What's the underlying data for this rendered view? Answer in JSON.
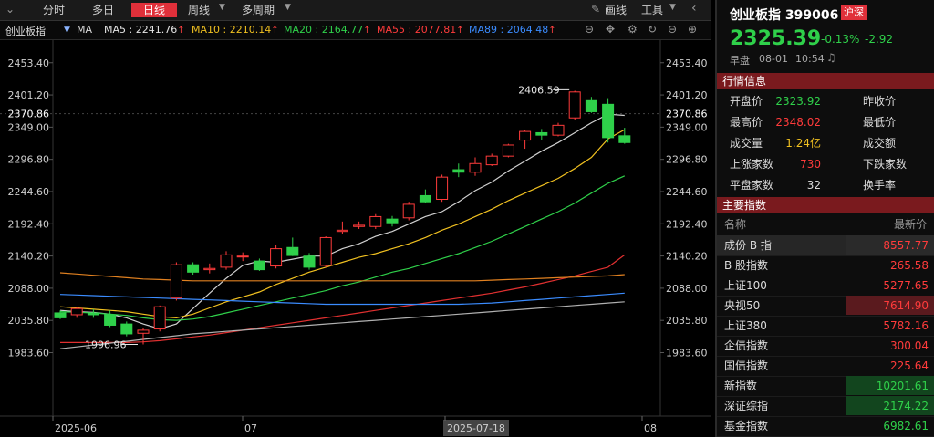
{
  "toolbar": {
    "tabs": [
      {
        "label": "分时",
        "active": false
      },
      {
        "label": "多日",
        "active": false
      },
      {
        "label": "日线",
        "active": true
      },
      {
        "label": "周线",
        "active": false
      },
      {
        "label": "多周期",
        "active": false
      }
    ],
    "draw_label": "画线",
    "tools_label": "工具"
  },
  "ma_bar": {
    "name": "创业板指",
    "ma_label": "MA",
    "items": [
      {
        "label": "MA5 : 2241.76",
        "color": "#e6e6e6"
      },
      {
        "label": "MA10 : 2210.14",
        "color": "#f0c020"
      },
      {
        "label": "MA20 : 2164.77",
        "color": "#2fd04a"
      },
      {
        "label": "MA55 : 2077.81",
        "color": "#ff3b3b"
      },
      {
        "label": "MA89 : 2064.48",
        "color": "#3b8cff"
      }
    ],
    "arrow": "↑"
  },
  "chart_data": {
    "type": "candlestick",
    "ylim": [
      1940,
      2490
    ],
    "y_ticks": [
      "2453.40",
      "2401.20",
      "2349.00",
      "2296.80",
      "2244.60",
      "2192.40",
      "2140.20",
      "2088.00",
      "2035.80",
      "1983.60"
    ],
    "current_price_label": "2370.86",
    "x_labels": [
      "2025-06",
      "07",
      "2025-07-18",
      "08"
    ],
    "annotations": {
      "high": "2406.59",
      "low": "1996.96"
    },
    "candles": [
      {
        "o": 2048,
        "h": 2052,
        "l": 2038,
        "c": 2040
      },
      {
        "o": 2045,
        "h": 2058,
        "l": 2040,
        "c": 2055
      },
      {
        "o": 2048,
        "h": 2054,
        "l": 2040,
        "c": 2045
      },
      {
        "o": 2045,
        "h": 2052,
        "l": 2025,
        "c": 2028
      },
      {
        "o": 2030,
        "h": 2034,
        "l": 2010,
        "c": 2014
      },
      {
        "o": 2015,
        "h": 2024,
        "l": 1997,
        "c": 2020
      },
      {
        "o": 2022,
        "h": 2060,
        "l": 2018,
        "c": 2058
      },
      {
        "o": 2072,
        "h": 2130,
        "l": 2068,
        "c": 2126
      },
      {
        "o": 2126,
        "h": 2130,
        "l": 2110,
        "c": 2114
      },
      {
        "o": 2118,
        "h": 2128,
        "l": 2112,
        "c": 2120
      },
      {
        "o": 2122,
        "h": 2148,
        "l": 2118,
        "c": 2142
      },
      {
        "o": 2140,
        "h": 2146,
        "l": 2132,
        "c": 2140
      },
      {
        "o": 2132,
        "h": 2136,
        "l": 2116,
        "c": 2118
      },
      {
        "o": 2124,
        "h": 2158,
        "l": 2120,
        "c": 2152
      },
      {
        "o": 2154,
        "h": 2170,
        "l": 2140,
        "c": 2141
      },
      {
        "o": 2140,
        "h": 2145,
        "l": 2118,
        "c": 2122
      },
      {
        "o": 2125,
        "h": 2172,
        "l": 2122,
        "c": 2170
      },
      {
        "o": 2180,
        "h": 2196,
        "l": 2176,
        "c": 2182
      },
      {
        "o": 2188,
        "h": 2196,
        "l": 2184,
        "c": 2190
      },
      {
        "o": 2188,
        "h": 2208,
        "l": 2184,
        "c": 2204
      },
      {
        "o": 2200,
        "h": 2205,
        "l": 2188,
        "c": 2194
      },
      {
        "o": 2202,
        "h": 2228,
        "l": 2198,
        "c": 2224
      },
      {
        "o": 2238,
        "h": 2248,
        "l": 2226,
        "c": 2228
      },
      {
        "o": 2232,
        "h": 2272,
        "l": 2228,
        "c": 2268
      },
      {
        "o": 2280,
        "h": 2290,
        "l": 2268,
        "c": 2276
      },
      {
        "o": 2276,
        "h": 2300,
        "l": 2270,
        "c": 2290
      },
      {
        "o": 2288,
        "h": 2306,
        "l": 2286,
        "c": 2302
      },
      {
        "o": 2302,
        "h": 2322,
        "l": 2300,
        "c": 2320
      },
      {
        "o": 2328,
        "h": 2344,
        "l": 2314,
        "c": 2342
      },
      {
        "o": 2340,
        "h": 2346,
        "l": 2328,
        "c": 2336
      },
      {
        "o": 2336,
        "h": 2356,
        "l": 2334,
        "c": 2352
      },
      {
        "o": 2364,
        "h": 2408,
        "l": 2360,
        "c": 2406
      },
      {
        "o": 2392,
        "h": 2398,
        "l": 2372,
        "c": 2374
      },
      {
        "o": 2386,
        "h": 2396,
        "l": 2324,
        "c": 2332
      },
      {
        "o": 2335,
        "h": 2348,
        "l": 2322,
        "c": 2324
      }
    ],
    "ma_lines": [
      {
        "name": "MA5",
        "color": "#d0d0d0",
        "values": [
          2052,
          2050,
          2049,
          2046,
          2040,
          2030,
          2022,
          2030,
          2055,
          2080,
          2104,
          2125,
          2132,
          2130,
          2135,
          2140,
          2140,
          2152,
          2160,
          2172,
          2180,
          2192,
          2204,
          2212,
          2228,
          2246,
          2260,
          2278,
          2294,
          2310,
          2324,
          2340,
          2356,
          2370,
          2368
        ]
      },
      {
        "name": "MA10",
        "color": "#f0c020",
        "values": [
          2058,
          2056,
          2054,
          2052,
          2050,
          2046,
          2042,
          2040,
          2046,
          2056,
          2066,
          2074,
          2082,
          2094,
          2104,
          2114,
          2122,
          2130,
          2138,
          2144,
          2152,
          2160,
          2170,
          2182,
          2192,
          2204,
          2216,
          2230,
          2242,
          2254,
          2266,
          2282,
          2300,
          2330,
          2345
        ]
      },
      {
        "name": "MA20",
        "color": "#2fd04a",
        "values": [
          2050,
          2049,
          2048,
          2046,
          2044,
          2040,
          2037,
          2036,
          2038,
          2042,
          2048,
          2054,
          2060,
          2066,
          2072,
          2078,
          2084,
          2092,
          2098,
          2106,
          2114,
          2120,
          2128,
          2136,
          2144,
          2154,
          2164,
          2176,
          2188,
          2200,
          2212,
          2226,
          2242,
          2258,
          2270
        ]
      },
      {
        "name": "MA55",
        "color": "#e03030",
        "values": [
          2000,
          2000,
          2000,
          2000,
          2000,
          2001,
          2003,
          2006,
          2009,
          2012,
          2016,
          2020,
          2024,
          2028,
          2032,
          2036,
          2040,
          2044,
          2048,
          2052,
          2056,
          2060,
          2064,
          2068,
          2072,
          2076,
          2080,
          2085,
          2090,
          2096,
          2102,
          2108,
          2115,
          2122,
          2142
        ]
      },
      {
        "name": "MA89",
        "color": "#3b8cff",
        "values": [
          2078,
          2077,
          2076,
          2075,
          2074,
          2073,
          2072,
          2071,
          2070,
          2069,
          2068,
          2067,
          2066,
          2065,
          2064,
          2063,
          2062,
          2062,
          2062,
          2062,
          2062,
          2062,
          2062,
          2062,
          2062,
          2063,
          2064,
          2066,
          2068,
          2070,
          2072,
          2074,
          2076,
          2078,
          2080
        ]
      },
      {
        "name": "MA120",
        "color": "#e08020",
        "values": [
          2113,
          2111,
          2109,
          2107,
          2105,
          2103,
          2102,
          2101,
          2100,
          2100,
          2100,
          2100,
          2100,
          2100,
          2100,
          2100,
          2100,
          2100,
          2100,
          2100,
          2100,
          2100,
          2100,
          2100,
          2100,
          2100,
          2101,
          2102,
          2103,
          2104,
          2105,
          2106,
          2107,
          2108,
          2110
        ]
      },
      {
        "name": "MA250",
        "color": "#b0b0b0",
        "values": [
          1990,
          1993,
          1996,
          1999,
          2002,
          2005,
          2008,
          2011,
          2014,
          2016,
          2018,
          2020,
          2022,
          2024,
          2026,
          2028,
          2030,
          2032,
          2034,
          2036,
          2038,
          2040,
          2042,
          2044,
          2046,
          2048,
          2050,
          2052,
          2054,
          2056,
          2058,
          2060,
          2062,
          2064,
          2066
        ]
      }
    ]
  },
  "quote": {
    "name": "创业板指 399006",
    "badge": "沪深",
    "price": "2325.39",
    "change_pct": "-0.13%",
    "change": "-2.92",
    "session": "早盘",
    "date": "08-01",
    "time": "10:54"
  },
  "market_info": {
    "title": "行情信息",
    "rows": [
      {
        "label": "开盘价",
        "value": "2323.92",
        "color": "#2fd04a",
        "label2": "昨收价"
      },
      {
        "label": "最高价",
        "value": "2348.02",
        "color": "#ff3b3b",
        "label2": "最低价"
      },
      {
        "label": "成交量",
        "value": "1.24亿",
        "color": "#f0c020",
        "label2": "成交额"
      },
      {
        "label": "上涨家数",
        "value": "730",
        "color": "#ff3b3b",
        "label2": "下跌家数"
      },
      {
        "label": "平盘家数",
        "value": "32",
        "color": "#dddddd",
        "label2": "换手率"
      }
    ]
  },
  "main_indices": {
    "title": "主要指数",
    "col_name": "名称",
    "col_price": "最新价",
    "rows": [
      {
        "name": "成份 B 指",
        "value": "8557.77",
        "color": "#ff3b3b",
        "bg": "#2a2a2a"
      },
      {
        "name": "B 股指数",
        "value": "265.58",
        "color": "#ff3b3b",
        "bg": ""
      },
      {
        "name": "上证100",
        "value": "5277.65",
        "color": "#ff3b3b",
        "bg": ""
      },
      {
        "name": "央视50",
        "value": "7614.90",
        "color": "#ff3b3b",
        "bg": "#5a1a1e"
      },
      {
        "name": "上证380",
        "value": "5782.16",
        "color": "#ff3b3b",
        "bg": ""
      },
      {
        "name": "企债指数",
        "value": "300.04",
        "color": "#ff3b3b",
        "bg": ""
      },
      {
        "name": "国债指数",
        "value": "225.64",
        "color": "#ff3b3b",
        "bg": ""
      },
      {
        "name": "新指数",
        "value": "10201.61",
        "color": "#2fd04a",
        "bg": "#12451e"
      },
      {
        "name": "深证综指",
        "value": "2174.22",
        "color": "#2fd04a",
        "bg": "#12451e"
      },
      {
        "name": "基金指数",
        "value": "6982.61",
        "color": "#2fd04a",
        "bg": ""
      }
    ]
  }
}
